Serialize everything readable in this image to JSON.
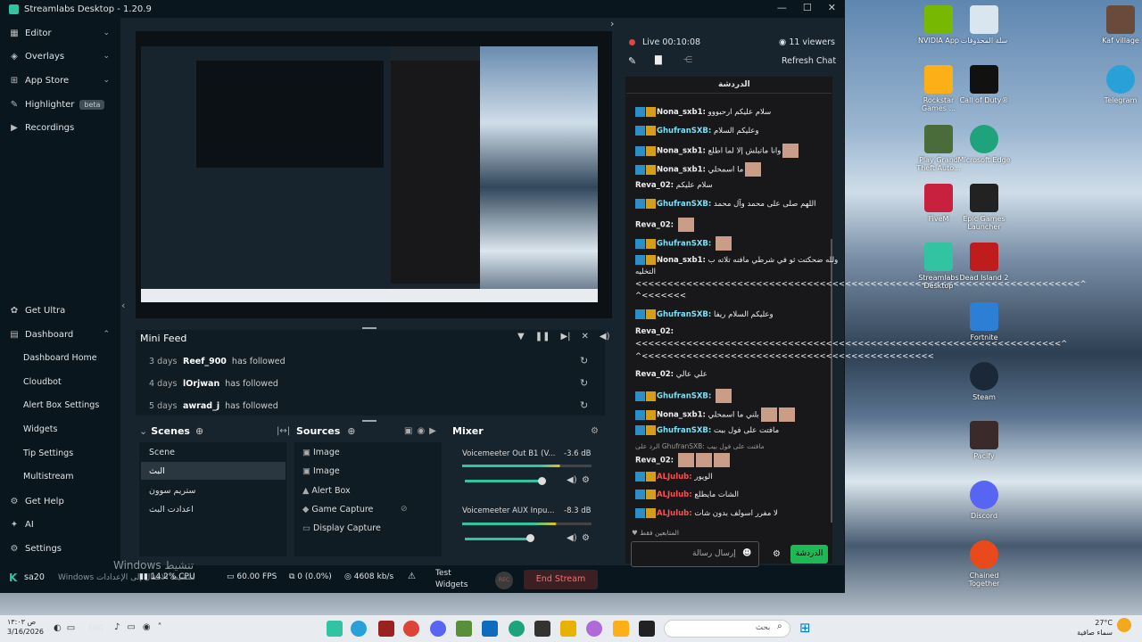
{
  "window": {
    "title": "Streamlabs Desktop - 1.20.9"
  },
  "sidebar": {
    "items": [
      {
        "label": "Editor"
      },
      {
        "label": "Overlays"
      },
      {
        "label": "App Store"
      },
      {
        "label": "Highlighter",
        "badge": "beta"
      },
      {
        "label": "Recordings"
      }
    ],
    "get_ultra": "Get Ultra",
    "dashboard": "Dashboard",
    "dashboard_items": [
      "Dashboard Home",
      "Cloudbot",
      "Alert Box Settings",
      "Widgets",
      "Tip Settings",
      "Multistream"
    ],
    "get_help": "Get Help",
    "ai": "AI",
    "settings": "Settings",
    "user": "sa20"
  },
  "mini_feed": {
    "title": "Mini Feed",
    "rows": [
      {
        "days": "3 days",
        "user": "Reef_900",
        "action": "has followed"
      },
      {
        "days": "4 days",
        "user": "lOrjwan",
        "action": "has followed"
      },
      {
        "days": "5 days",
        "user": "awrad_j",
        "action": "has followed"
      }
    ]
  },
  "scenes": {
    "title": "Scenes",
    "items": [
      "Scene",
      "البث",
      "ستريم سوون",
      "اعدادت البث"
    ]
  },
  "sources": {
    "title": "Sources",
    "items": [
      "Image",
      "Image",
      "Alert Box",
      "Game Capture",
      "Display Capture"
    ]
  },
  "mixer": {
    "title": "Mixer",
    "channels": [
      {
        "name": "Voicemeeter Out B1 (V...",
        "db": "-3.6 dB"
      },
      {
        "name": "Voicemeeter AUX Inpu...",
        "db": "-8.3 dB"
      }
    ]
  },
  "status": {
    "cpu": "14.2% CPU",
    "fps": "60.00 FPS",
    "dropped": "0 (0.0%)",
    "bitrate": "4608 kb/s",
    "test_widgets": "Test Widgets",
    "rec": "REC",
    "end_stream": "End Stream",
    "watermark1": "Windows تنشيط",
    "watermark2": "Windows لتنشيط الانتقال إلى الإعدادات"
  },
  "live": {
    "label": "Live 00:10:08",
    "viewers": "11 viewers",
    "refresh": "Refresh Chat"
  },
  "chat": {
    "header": "الدردشة",
    "messages": [
      {
        "user": "Nona_sxb1:",
        "text": "سلام عليكم ارحبووو",
        "badges": 2
      },
      {
        "user": "GhufranSXB:",
        "text": "وعليكم السلام",
        "badges": 2
      },
      {
        "user": "Nona_sxb1:",
        "text": "وانا ماتبلش إلا لما اطلع",
        "badges": 2
      },
      {
        "user": "Nona_sxb1:",
        "text": "ما اسمحلي",
        "badges": 2
      },
      {
        "user": "Reva_02:",
        "text": "سلام عليكم",
        "badges": 0
      },
      {
        "user": "GhufranSXB:",
        "text": "اللهم صلى على محمد وآل محمد",
        "badges": 2
      },
      {
        "user": "Reva_02:",
        "text": "",
        "badges": 0
      },
      {
        "user": "GhufranSXB:",
        "text": "",
        "badges": 2
      },
      {
        "user": "Nona_sxb1:",
        "text": "ولله ضحكتت ثو في شرطي مافنه تلاته ب",
        "badges": 2
      },
      {
        "user": "",
        "text": "التخليه",
        "badges": 0
      },
      {
        "user": "",
        "text": "<<<<<<<<<<<<<<<<<<<<<<<<<<<<<<<<<<<<<<<<<<<<<<<<<<<<<<<<<<<<<<<<<<<<<<^",
        "badges": 0
      },
      {
        "user": "",
        "text": "^<<<<<<<",
        "badges": 0
      },
      {
        "user": "GhufranSXB:",
        "text": "وعليكم السلام ريفا",
        "badges": 2
      },
      {
        "user": "Reva_02:",
        "text": "",
        "badges": 0
      },
      {
        "user": "",
        "text": "<<<<<<<<<<<<<<<<<<<<<<<<<<<<<<<<<<<<<<<<<<<<<<<<<<<<<<<<<<<<<<<<<<<^",
        "badges": 0
      },
      {
        "user": "",
        "text": "^<<<<<<<<<<<<<<<<<<<<<<<<<<<<<<<<<<<<<<<<<<<<<<",
        "badges": 0
      },
      {
        "user": "Reva_02:",
        "text": "علي عالي",
        "badges": 0
      },
      {
        "user": "GhufranSXB:",
        "text": "",
        "badges": 2
      },
      {
        "user": "Nona_sxb1:",
        "text": "بلني ما اسمحلي",
        "badges": 2
      },
      {
        "user": "GhufranSXB:",
        "text": "مافتت على فول ببت",
        "badges": 2
      },
      {
        "user": "",
        "text": "الرد على GhufranSXB: مافتت على فول بيب",
        "badges": 0
      },
      {
        "user": "Reva_02:",
        "text": "",
        "badges": 0
      },
      {
        "user": "ALJulub:",
        "text": "الويور",
        "badges": 2
      },
      {
        "user": "ALJulub:",
        "text": "الشات مايطلع",
        "badges": 2
      },
      {
        "user": "ALJulub:",
        "text": "لا مفرر اسولف بدون شات",
        "badges": 2
      }
    ],
    "followers_only": "المتابعين فقط",
    "placeholder": "إرسال رسالة",
    "send": "الدردشة"
  },
  "desktop": {
    "icons": [
      "NVIDIA App",
      "سلة المحذوفات",
      "Kaf village",
      "Rockstar Games ...",
      "Call of Duty®",
      "Telegram",
      "Play Grand Theft Auto...",
      "Microsoft Edge",
      "FiveM",
      "Epic Games Launcher",
      "Streamlabs Desktop",
      "Dead Island 2",
      "Fortnite",
      "Steam",
      "Pacify",
      "Discord",
      "Chained Together"
    ]
  },
  "taskbar": {
    "time": "۱۳:۰۳ ص",
    "date": "3/16/2026",
    "lang": "ENG",
    "search": "بحث",
    "weather_temp": "27°C",
    "weather_desc": "سماء صافية"
  }
}
